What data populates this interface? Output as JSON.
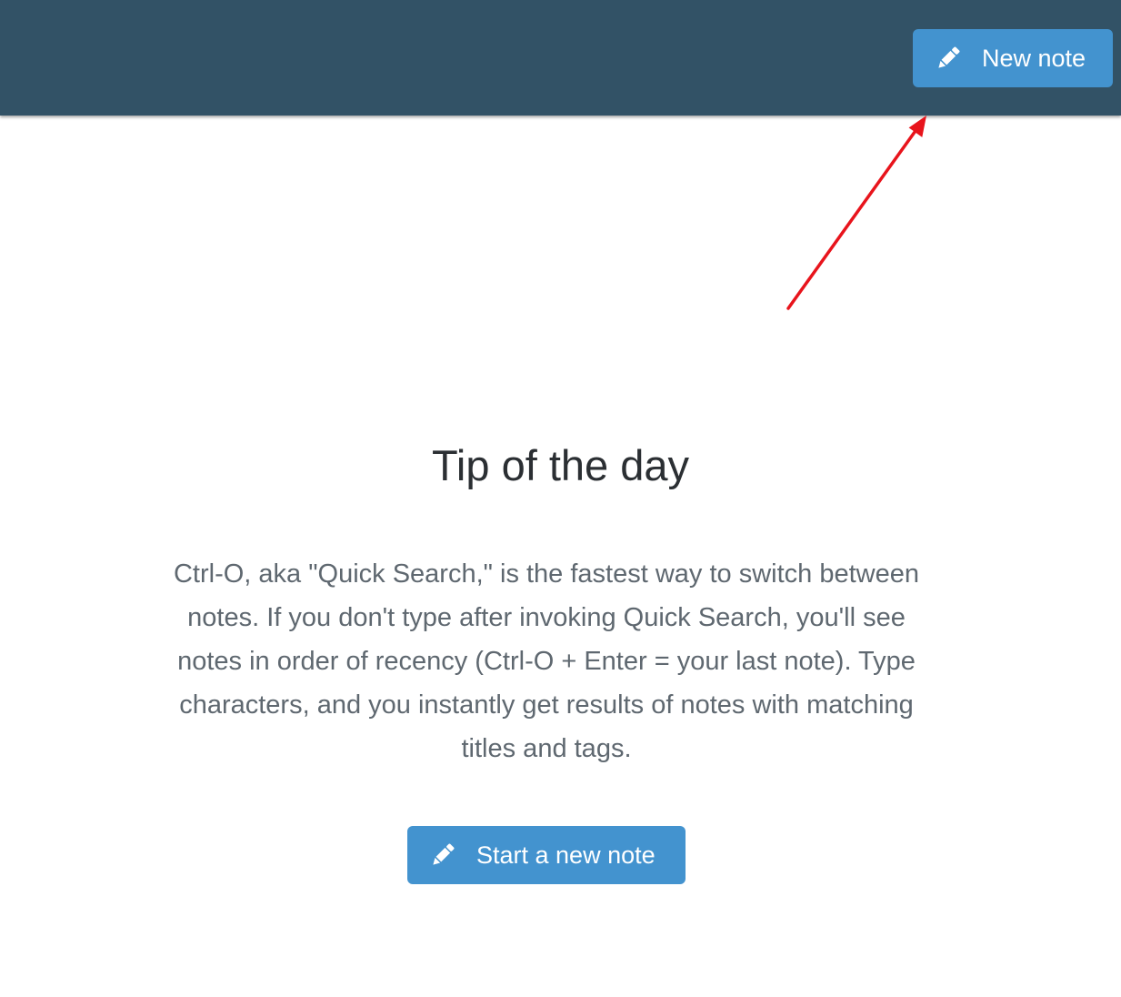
{
  "header": {
    "new_note_label": "New note",
    "icon": "pencil-icon",
    "background_color": "#325266"
  },
  "tip": {
    "title": "Tip of the day",
    "body": "Ctrl-O, aka \"Quick Search,\" is the fastest way to switch between notes. If you don't type after invoking Quick Search, you'll see notes in order of recency (Ctrl-O + Enter = your last note). Type characters, and you instantly get results of notes with matching titles and tags."
  },
  "actions": {
    "start_note_label": "Start a new note",
    "icon": "pencil-icon"
  },
  "colors": {
    "button": "#4393cf",
    "annotation_arrow": "#e8141c"
  }
}
